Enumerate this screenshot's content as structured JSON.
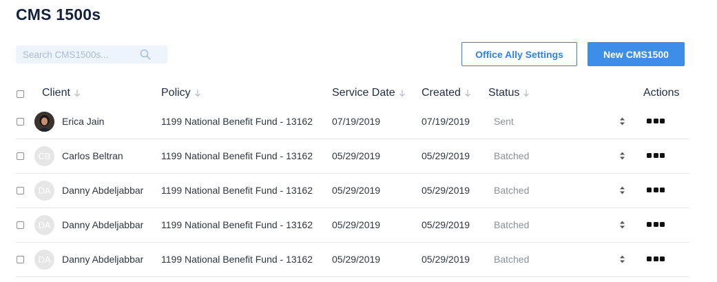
{
  "page": {
    "title": "CMS 1500s"
  },
  "search": {
    "placeholder": "Search CMS1500s..."
  },
  "buttons": {
    "settings": "Office Ally Settings",
    "new": "New CMS1500"
  },
  "table": {
    "headers": {
      "client": "Client",
      "policy": "Policy",
      "service_date": "Service Date",
      "created": "Created",
      "status": "Status",
      "actions": "Actions"
    },
    "rows": [
      {
        "initials": "",
        "client": "Erica Jain",
        "policy": "1199 National Benefit Fund - 13162",
        "service_date": "07/19/2019",
        "created": "07/19/2019",
        "status": "Sent"
      },
      {
        "initials": "CB",
        "client": "Carlos Beltran",
        "policy": "1199 National Benefit Fund - 13162",
        "service_date": "05/29/2019",
        "created": "05/29/2019",
        "status": "Batched"
      },
      {
        "initials": "DA",
        "client": "Danny Abdeljabbar",
        "policy": "1199 National Benefit Fund - 13162",
        "service_date": "05/29/2019",
        "created": "05/29/2019",
        "status": "Batched"
      },
      {
        "initials": "DA",
        "client": "Danny Abdeljabbar",
        "policy": "1199 National Benefit Fund - 13162",
        "service_date": "05/29/2019",
        "created": "05/29/2019",
        "status": "Batched"
      },
      {
        "initials": "DA",
        "client": "Danny Abdeljabbar",
        "policy": "1199 National Benefit Fund - 13162",
        "service_date": "05/29/2019",
        "created": "05/29/2019",
        "status": "Batched"
      }
    ]
  },
  "colors": {
    "accent": "#2f80ed",
    "primary_button": "#3d8ee8",
    "title": "#13213f",
    "status_text": "#8a8f98"
  },
  "icons": {
    "search": "search-icon",
    "sort": "sort-arrow-icon",
    "row_sort": "up-down-icon",
    "actions": "more-dots-icon"
  }
}
